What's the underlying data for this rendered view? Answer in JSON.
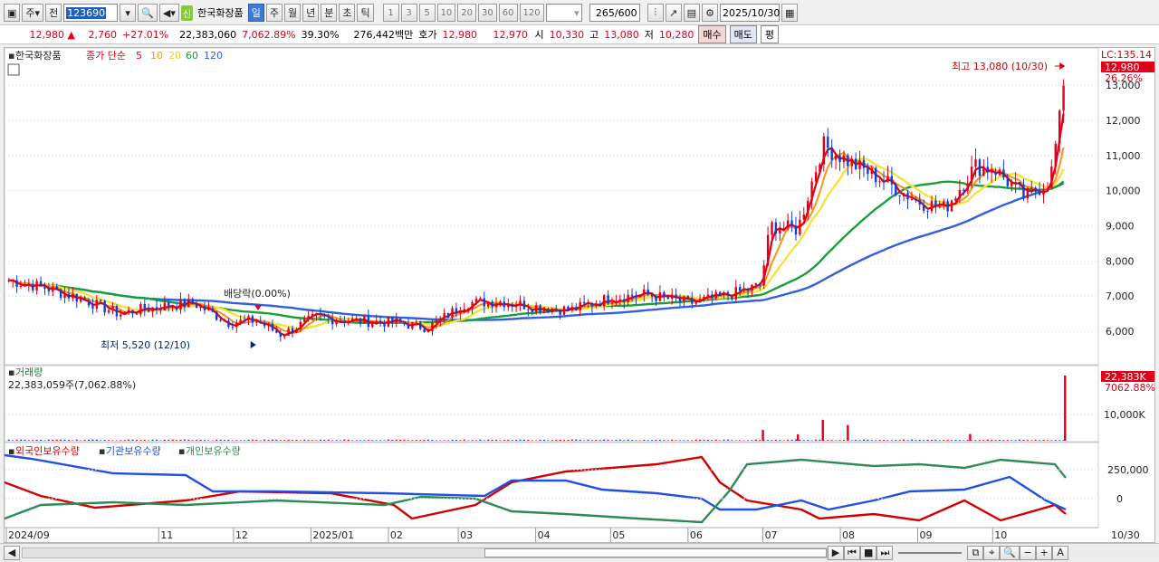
{
  "toolbar": {
    "period_options": [
      "주",
      "전"
    ],
    "code": "123690",
    "badge": "신",
    "stock_name": "한국화장품",
    "period_tabs": [
      "일",
      "주",
      "월",
      "년",
      "분",
      "초",
      "틱"
    ],
    "active_period": "일",
    "interval_buttons": [
      "1",
      "3",
      "5",
      "10",
      "20",
      "30",
      "60",
      "120"
    ],
    "count": "265",
    "count_total": "/600",
    "date": "2025/10/30"
  },
  "quote": {
    "price": "12,980",
    "arrow": "▲",
    "change": "2,760",
    "change_pct": "+27.01%",
    "volume": "22,383,060",
    "volume_ratio": "7,062.89%",
    "turnover": "39.30%",
    "amount": "276,442백만",
    "ask_label": "호가",
    "ask": "12,980",
    "bid": "12,970",
    "open_label": "시",
    "open": "10,330",
    "high_label": "고",
    "high": "13,080",
    "low_label": "저",
    "low": "10,280",
    "buy_label": "매수",
    "sell_label": "매도",
    "eval_label": "평"
  },
  "chart_data": [
    {
      "type": "candlestick",
      "legend": {
        "name": "한국화장품",
        "ma_label": "종가 단순",
        "ma_periods": [
          "5",
          "10",
          "20",
          "60",
          "120"
        ],
        "ma_colors": [
          "#e0001a",
          "#f7941d",
          "#f4e43a",
          "#1a9e3a",
          "#3060e0"
        ]
      },
      "y_ticks": [
        "13,000",
        "12,000",
        "11,000",
        "10,000",
        "9,000",
        "8,000",
        "7,000",
        "6,000"
      ],
      "ylim": [
        5200,
        13700
      ],
      "lc_label": "LC:135.14",
      "price_badge": "12,980",
      "price_badge_pct": "26.26%",
      "high_annotation": "최고 13,080 (10/30)",
      "low_annotation": "최저 5,520 (12/10)",
      "dividend_annotation": "배당락(0.00%)",
      "close_points": [
        [
          "2024-09-02",
          7450
        ],
        [
          "2024-09-16",
          7250
        ],
        [
          "2024-10-02",
          6900
        ],
        [
          "2024-10-16",
          6500
        ],
        [
          "2024-11-01",
          6700
        ],
        [
          "2024-11-15",
          6800
        ],
        [
          "2024-11-29",
          6250
        ],
        [
          "2024-12-10",
          6300
        ],
        [
          "2024-12-20",
          5900
        ],
        [
          "2025-01-03",
          6400
        ],
        [
          "2025-01-17",
          6300
        ],
        [
          "2025-02-03",
          6250
        ],
        [
          "2025-02-17",
          6100
        ],
        [
          "2025-03-04",
          6800
        ],
        [
          "2025-03-18",
          6850
        ],
        [
          "2025-04-01",
          6700
        ],
        [
          "2025-04-15",
          6600
        ],
        [
          "2025-05-01",
          6950
        ],
        [
          "2025-05-15",
          7050
        ],
        [
          "2025-06-02",
          6800
        ],
        [
          "2025-06-16",
          7000
        ],
        [
          "2025-06-30",
          7300
        ],
        [
          "2025-07-04",
          9000
        ],
        [
          "2025-07-15",
          8900
        ],
        [
          "2025-07-25",
          11300
        ],
        [
          "2025-08-05",
          10800
        ],
        [
          "2025-08-18",
          10300
        ],
        [
          "2025-09-01",
          9700
        ],
        [
          "2025-09-12",
          9500
        ],
        [
          "2025-09-24",
          10700
        ],
        [
          "2025-10-02",
          10600
        ],
        [
          "2025-10-14",
          9800
        ],
        [
          "2025-10-24",
          10300
        ],
        [
          "2025-10-30",
          12980
        ]
      ]
    },
    {
      "type": "bar",
      "title": "거래량",
      "value_label": "22,383,059주(7,062.88%)",
      "y_tick": "10,000K",
      "badge_value": "22,383K",
      "badge_pct": "7062.88%",
      "spikes": [
        [
          "2025-07-01",
          3700
        ],
        [
          "2025-07-15",
          2200
        ],
        [
          "2025-07-25",
          7200
        ],
        [
          "2025-08-04",
          5400
        ],
        [
          "2025-09-22",
          2300
        ],
        [
          "2025-10-30",
          22383
        ]
      ],
      "ylim": [
        0,
        23000
      ]
    },
    {
      "type": "line",
      "series": [
        {
          "name": "외국인보유수량",
          "color": "#d40000"
        },
        {
          "name": "기관보유수량",
          "color": "#2050e0"
        },
        {
          "name": "개인보유수량",
          "color": "#2e8b57"
        }
      ],
      "y_ticks": [
        "250,000",
        "0"
      ]
    }
  ],
  "x_axis": {
    "labels": [
      "2024/09",
      "11",
      "12",
      "2025/01",
      "02",
      "03",
      "04",
      "05",
      "06",
      "07",
      "08",
      "09",
      "10"
    ],
    "end_label": "10/30"
  }
}
